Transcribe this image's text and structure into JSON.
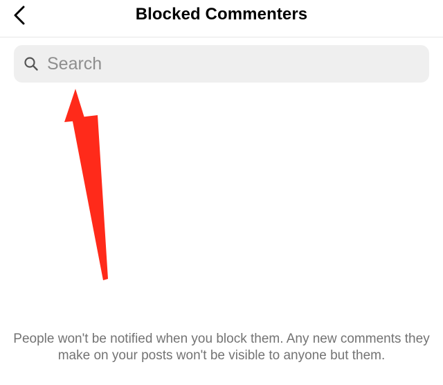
{
  "header": {
    "title": "Blocked Commenters",
    "back_icon": "chevron-left-icon"
  },
  "search": {
    "placeholder": "Search",
    "icon": "search-icon",
    "value": ""
  },
  "annotation": {
    "type": "arrow",
    "color": "#ff2a1a",
    "points_to": "search-input"
  },
  "info": {
    "text": "People won't be notified when you block them. Any new comments they make on your posts won't be visible to anyone but them."
  }
}
